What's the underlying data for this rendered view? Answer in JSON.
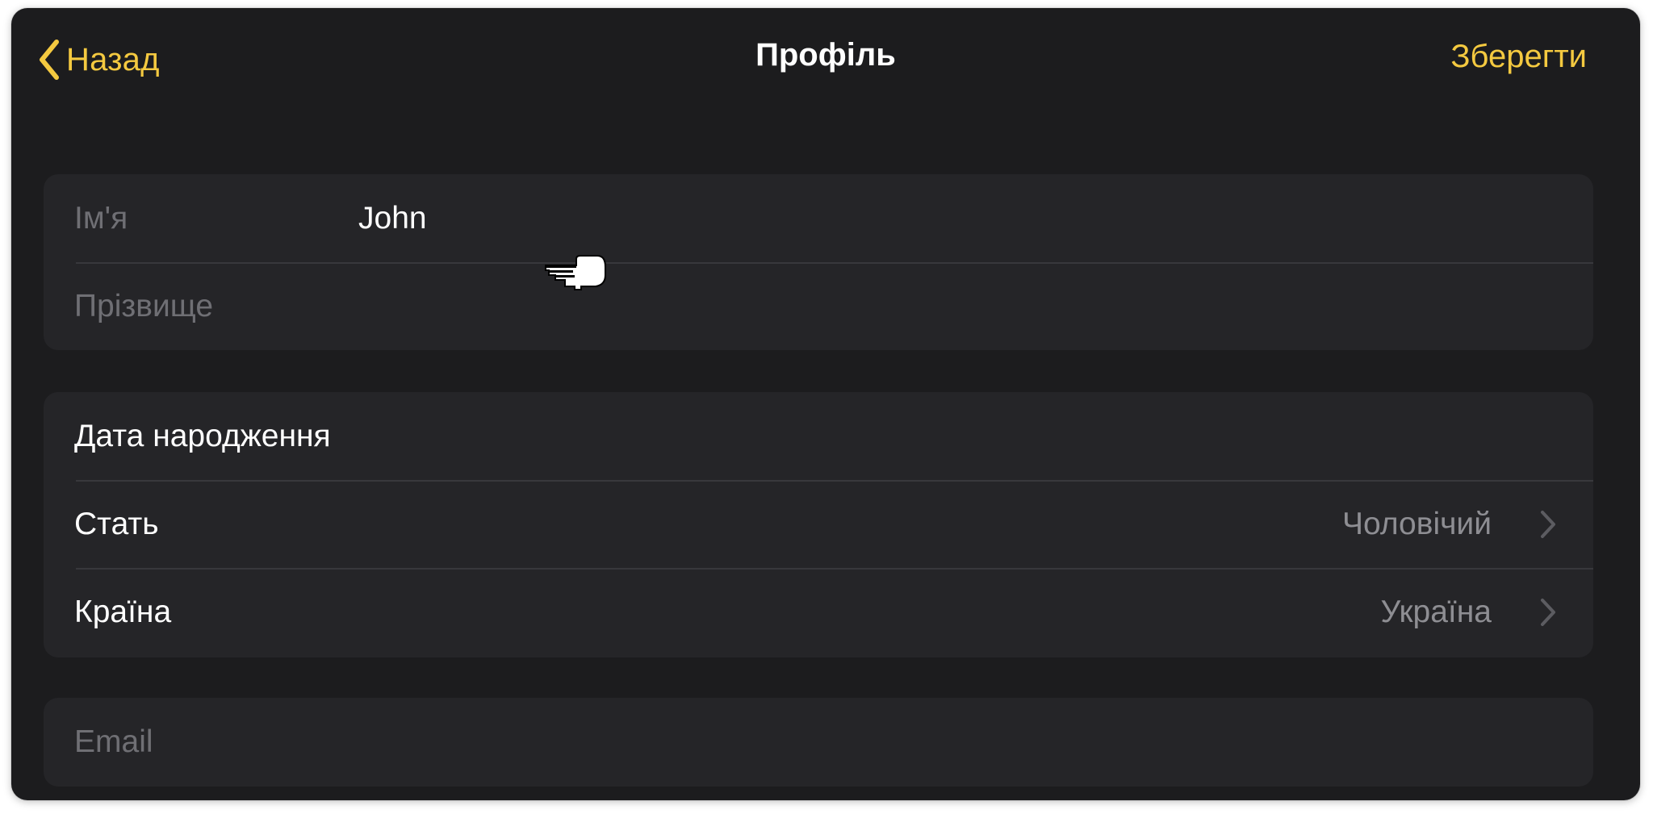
{
  "navbar": {
    "back_label": "Назад",
    "title": "Профіль",
    "save_label": "Зберегти"
  },
  "name_section": {
    "first_name": {
      "label": "Ім'я",
      "value": "John"
    },
    "last_name": {
      "label": "Прізвище",
      "value": ""
    }
  },
  "details_section": {
    "birth_date": {
      "label": "Дата народження"
    },
    "gender": {
      "label": "Стать",
      "value": "Чоловічий"
    },
    "country": {
      "label": "Країна",
      "value": "Україна"
    }
  },
  "email_section": {
    "email": {
      "label": "Email",
      "value": ""
    }
  },
  "colors": {
    "accent": "#f4c940",
    "background": "#1c1c1e",
    "group_background": "#252528",
    "separator": "#38383c",
    "secondary_text": "#8e8e93",
    "placeholder_text": "#6f6f74"
  },
  "icons": {
    "back": "chevron-left-icon",
    "disclosure": "chevron-right-icon",
    "pointer": "pointing-hand-cursor-icon"
  }
}
